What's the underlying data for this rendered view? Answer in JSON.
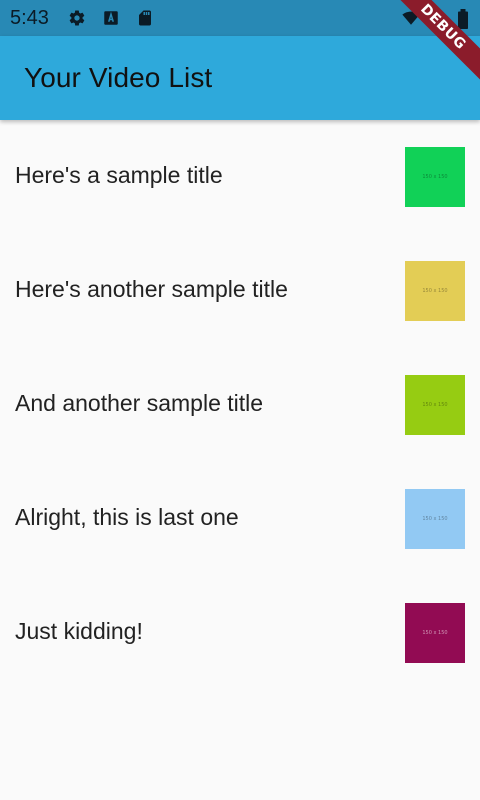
{
  "status_bar": {
    "time": "5:43",
    "icons": [
      "settings-gear-icon",
      "accessibility-a-icon",
      "sd-card-icon",
      "wifi-icon",
      "battery-icon"
    ]
  },
  "app_bar": {
    "title": "Your Video List",
    "debug_banner": "DEBUG",
    "color": "#2ea9db"
  },
  "videos": [
    {
      "title": "Here's a sample title",
      "thumbnail_text": "150 x 150",
      "thumbnail_color": "#11d157"
    },
    {
      "title": "Here's another sample title",
      "thumbnail_text": "150 x 150",
      "thumbnail_color": "#e3cd55"
    },
    {
      "title": "And another sample title",
      "thumbnail_text": "150 x 150",
      "thumbnail_color": "#96cc12"
    },
    {
      "title": "Alright, this is last one",
      "thumbnail_text": "150 x 150",
      "thumbnail_color": "#92c9f3"
    },
    {
      "title": "Just kidding!",
      "thumbnail_text": "150 x 150",
      "thumbnail_color": "#920b53"
    }
  ]
}
